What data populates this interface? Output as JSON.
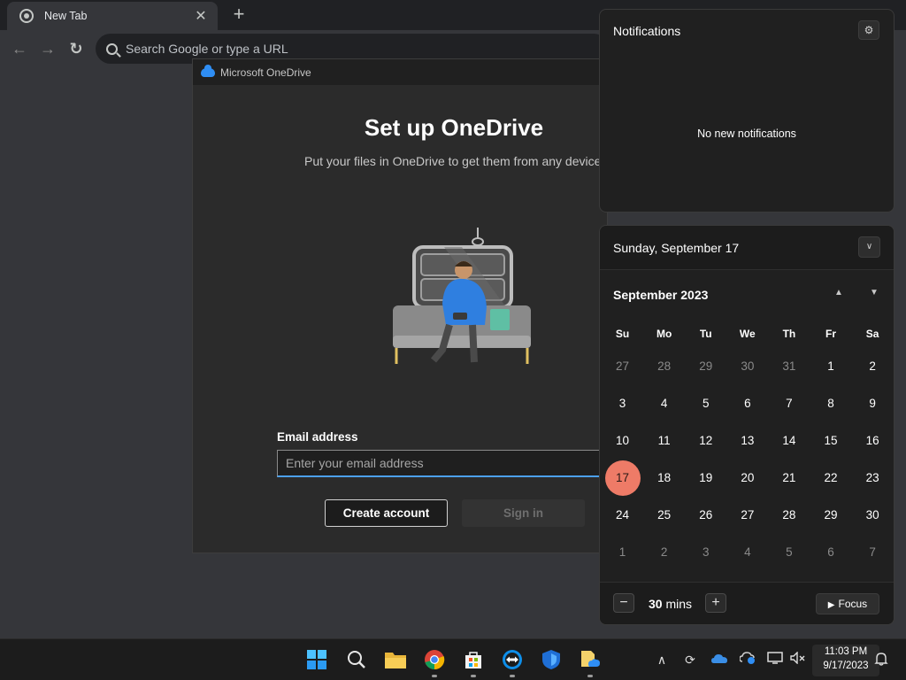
{
  "browser": {
    "tab_title": "New Tab",
    "tab_close": "✕",
    "new_tab": "+",
    "back": "←",
    "forward": "→",
    "reload": "↻",
    "omnibox_placeholder": "Search Google or type a URL"
  },
  "onedrive": {
    "window_title": "Microsoft OneDrive",
    "heading": "Set up OneDrive",
    "subtitle": "Put your files in OneDrive to get them from any device",
    "email_label": "Email address",
    "email_placeholder": "Enter your email address",
    "email_value": "",
    "create_account": "Create account",
    "sign_in": "Sign in"
  },
  "notifications": {
    "title": "Notifications",
    "empty_text": "No new notifications"
  },
  "calendar": {
    "selected_date": "Sunday, September 17",
    "month_label": "September 2023",
    "days_of_week": [
      "Su",
      "Mo",
      "Tu",
      "We",
      "Th",
      "Fr",
      "Sa"
    ],
    "weeks": [
      [
        {
          "d": "27",
          "m": true
        },
        {
          "d": "28",
          "m": true
        },
        {
          "d": "29",
          "m": true
        },
        {
          "d": "30",
          "m": true
        },
        {
          "d": "31",
          "m": true
        },
        {
          "d": "1"
        },
        {
          "d": "2"
        }
      ],
      [
        {
          "d": "3"
        },
        {
          "d": "4"
        },
        {
          "d": "5"
        },
        {
          "d": "6"
        },
        {
          "d": "7"
        },
        {
          "d": "8"
        },
        {
          "d": "9"
        }
      ],
      [
        {
          "d": "10"
        },
        {
          "d": "11"
        },
        {
          "d": "12"
        },
        {
          "d": "13"
        },
        {
          "d": "14"
        },
        {
          "d": "15"
        },
        {
          "d": "16"
        }
      ],
      [
        {
          "d": "17",
          "today": true
        },
        {
          "d": "18"
        },
        {
          "d": "19"
        },
        {
          "d": "20"
        },
        {
          "d": "21"
        },
        {
          "d": "22"
        },
        {
          "d": "23"
        }
      ],
      [
        {
          "d": "24"
        },
        {
          "d": "25"
        },
        {
          "d": "26"
        },
        {
          "d": "27"
        },
        {
          "d": "28"
        },
        {
          "d": "29"
        },
        {
          "d": "30"
        }
      ],
      [
        {
          "d": "1",
          "m": true
        },
        {
          "d": "2",
          "m": true
        },
        {
          "d": "3",
          "m": true
        },
        {
          "d": "4",
          "m": true
        },
        {
          "d": "5",
          "m": true
        },
        {
          "d": "6",
          "m": true
        },
        {
          "d": "7",
          "m": true
        }
      ]
    ],
    "today_color": "#ee7b67",
    "focus_minutes": "30",
    "focus_unit": "mins",
    "focus_button": "Focus",
    "minus": "−",
    "plus": "+"
  },
  "taskbar": {
    "apps": [
      "start-icon",
      "search-icon",
      "file-explorer-icon",
      "chrome-icon",
      "microsoft-store-icon",
      "teamviewer-icon",
      "defender-icon",
      "onedrive-folder-icon"
    ],
    "tray_icons": [
      "chevron-up-icon",
      "sync-icon",
      "onedrive-cloud-icon",
      "onedrive-info-icon",
      "display-icon",
      "volume-muted-icon",
      "bell-icon"
    ],
    "time": "11:03 PM",
    "date": "9/17/2023"
  }
}
